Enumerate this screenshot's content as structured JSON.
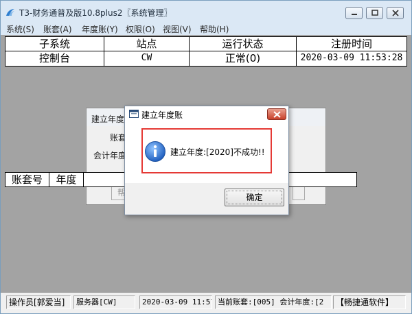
{
  "window": {
    "title": "T3-财务通普及版10.8plus2〖系统管理〗",
    "icons": {
      "app": "app-logo-icon",
      "minimize": "minimize-icon",
      "maximize": "maximize-icon",
      "close": "close-icon"
    }
  },
  "menu": {
    "items": [
      "系统(S)",
      "账套(A)",
      "年度账(Y)",
      "权限(O)",
      "视图(V)",
      "帮助(H)"
    ]
  },
  "table": {
    "headers": [
      "子系统",
      "站点",
      "运行状态",
      "注册时间"
    ],
    "rows": [
      [
        "控制台",
        "CW",
        "正常(0)",
        "2020-03-09 11:53:28"
      ]
    ]
  },
  "background_dialog": {
    "title_fragment": "建立年度",
    "label_account": "账套",
    "label_year": "会计年度",
    "button_fragment": "帮"
  },
  "background_table": {
    "headers": [
      "账套号",
      "年度"
    ]
  },
  "modal": {
    "title": "建立年度账",
    "message": "建立年度:[2020]不成功!!",
    "ok_label": "确定",
    "icons": {
      "title": "window-icon",
      "close": "close-icon",
      "info": "info-icon"
    },
    "colors": {
      "highlight": "#e53935",
      "close": "#c9402a",
      "info": "#1f5fbf"
    }
  },
  "statusbar": {
    "operator": "操作员[郭爱当]",
    "server": "服务器[CW]",
    "datetime": "2020-03-09 11:57",
    "current": "当前账套:[005] 会计年度:[2",
    "brand": "【畅捷通软件】"
  }
}
